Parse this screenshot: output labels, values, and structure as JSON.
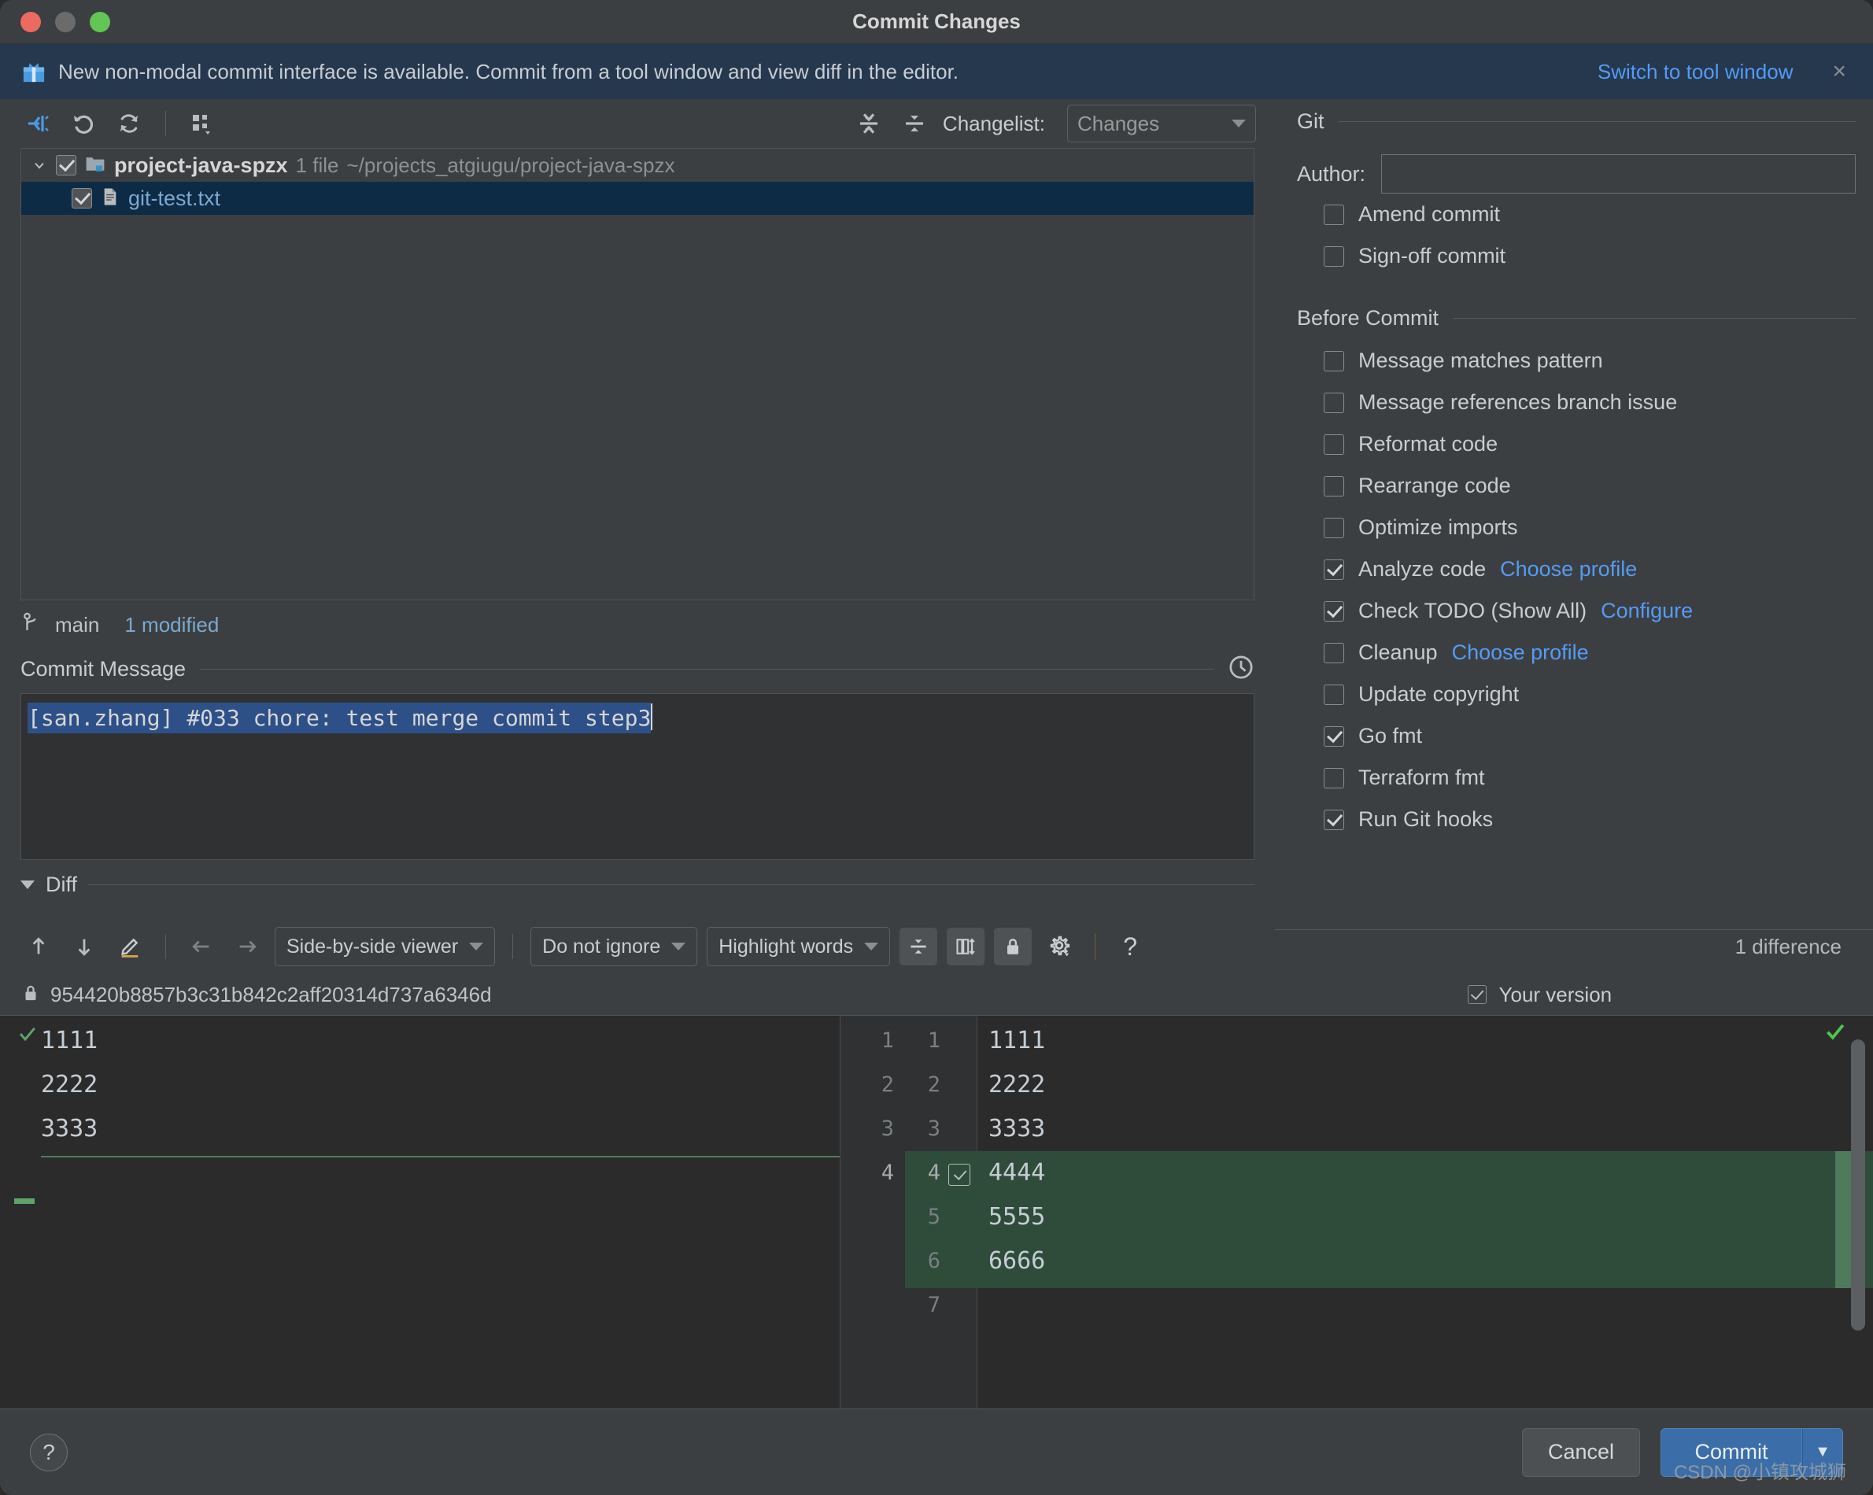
{
  "window": {
    "title": "Commit Changes"
  },
  "banner": {
    "icon": "gift-icon",
    "text": "New non-modal commit interface is available. Commit from a tool window and view diff in the editor.",
    "link": "Switch to tool window",
    "close": "×"
  },
  "changes_toolbar": {
    "buttons": [
      {
        "name": "collapse-to-changes-icon",
        "label": ""
      },
      {
        "name": "rollback-icon",
        "label": ""
      },
      {
        "name": "refresh-icon",
        "label": ""
      },
      {
        "name": "group-by-icon",
        "label": ""
      },
      {
        "name": "expand-all-icon",
        "label": ""
      },
      {
        "name": "collapse-all-icon",
        "label": ""
      }
    ],
    "changelist_label": "Changelist:",
    "changelist_value": "Changes"
  },
  "file_tree": {
    "root": {
      "name": "project-java-spzx",
      "count": "1 file",
      "path": "~/projects_atgiugu/project-java-spzx",
      "checked": true,
      "expanded": true
    },
    "files": [
      {
        "name": "git-test.txt",
        "checked": true,
        "selected": true
      }
    ]
  },
  "branch_bar": {
    "branch": "main",
    "modified": "1 modified"
  },
  "commit_message": {
    "section_title": "Commit Message",
    "history_icon": "history-clock-icon",
    "value": "[san.zhang] #033 chore: test merge commit step3",
    "selected": true
  },
  "diff": {
    "section_title": "Diff",
    "toolbar": {
      "prev_diff_icon": "arrow-up-icon",
      "next_diff_icon": "arrow-down-icon",
      "editor_icon": "edit-source-icon",
      "apply_left_icon": "arrow-left-icon",
      "apply_right_icon": "arrow-right-icon",
      "viewer_mode": "Side-by-side viewer",
      "ignore_mode": "Do not ignore",
      "highlight_mode": "Highlight words",
      "collapse_unchanged_icon": "collapse-unchanged-icon",
      "synchronize_scroll_icon": "synchronize-scroll-icon",
      "read_only_icon": "lock-icon",
      "settings_icon": "gear-icon",
      "help_icon": "question-icon",
      "difference_count": "1 difference"
    },
    "left_title": "954420b8857b3c31b842c2aff20314d737a6346d",
    "left_title_icon": "lock-icon",
    "right_title": "Your version",
    "right_title_checked": true,
    "left_lines": [
      {
        "num": "",
        "text": "1111"
      },
      {
        "num": "",
        "text": "2222"
      },
      {
        "num": "",
        "text": "3333"
      }
    ],
    "left_line_numbers": [
      "1",
      "2",
      "3",
      "4"
    ],
    "right_line_numbers": [
      "1",
      "2",
      "3",
      "4",
      "5",
      "6",
      "7"
    ],
    "right_lines": [
      {
        "text": "1111",
        "added": false,
        "accept": false
      },
      {
        "text": "2222",
        "added": false,
        "accept": false
      },
      {
        "text": "3333",
        "added": false,
        "accept": false
      },
      {
        "text": "4444",
        "added": true,
        "accept": true
      },
      {
        "text": "5555",
        "added": true,
        "accept": false
      },
      {
        "text": "6666",
        "added": true,
        "accept": false
      },
      {
        "text": "",
        "added": false,
        "accept": false
      }
    ]
  },
  "git_panel": {
    "section_git": "Git",
    "author_label": "Author:",
    "author_value": "",
    "author_placeholder": "",
    "options": [
      {
        "label": "Amend commit",
        "checked": false
      },
      {
        "label": "Sign-off commit",
        "checked": false
      }
    ],
    "section_before_commit": "Before Commit",
    "before_commit": [
      {
        "label": "Message matches pattern",
        "checked": false,
        "link": ""
      },
      {
        "label": "Message references branch issue",
        "checked": false,
        "link": ""
      },
      {
        "label": "Reformat code",
        "checked": false,
        "link": ""
      },
      {
        "label": "Rearrange code",
        "checked": false,
        "link": ""
      },
      {
        "label": "Optimize imports",
        "checked": false,
        "link": ""
      },
      {
        "label": "Analyze code",
        "checked": true,
        "link": "Choose profile"
      },
      {
        "label": "Check TODO (Show All)",
        "checked": true,
        "link": "Configure"
      },
      {
        "label": "Cleanup",
        "checked": false,
        "link": "Choose profile"
      },
      {
        "label": "Update copyright",
        "checked": false,
        "link": ""
      },
      {
        "label": "Go fmt",
        "checked": true,
        "link": ""
      },
      {
        "label": "Terraform fmt",
        "checked": false,
        "link": ""
      },
      {
        "label": "Run Git hooks",
        "checked": true,
        "link": ""
      }
    ]
  },
  "footer": {
    "help_label": "?",
    "cancel_label": "Cancel",
    "commit_label": "Commit",
    "commit_arrow": "▼"
  },
  "watermark": "CSDN @小镇攻城狮",
  "colors": {
    "accent_blue": "#549bf5",
    "banner_bg": "#25384e",
    "selection_blue": "#2d5088",
    "added_green": "#2f4c3a",
    "commit_button": "#3b6ea8"
  }
}
